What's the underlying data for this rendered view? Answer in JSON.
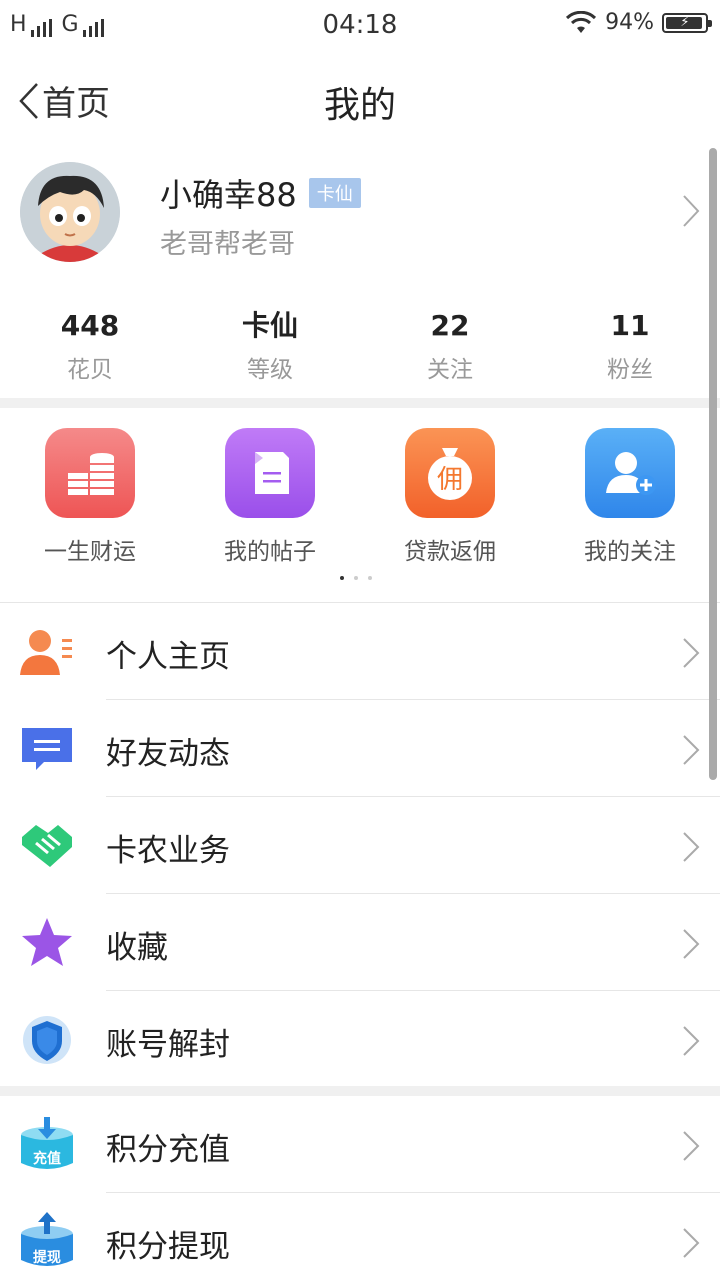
{
  "status_bar": {
    "carrier": "H",
    "network": "G",
    "time": "04:18",
    "battery": "94%",
    "battery_level": 0.94
  },
  "nav": {
    "back_label": "首页",
    "title": "我的"
  },
  "profile": {
    "username": "小确幸88",
    "level_badge": "卡仙",
    "signature": "老哥帮老哥",
    "stats": [
      {
        "value": "448",
        "label": "花贝"
      },
      {
        "value": "卡仙",
        "label": "等级"
      },
      {
        "value": "22",
        "label": "关注"
      },
      {
        "value": "11",
        "label": "粉丝"
      }
    ]
  },
  "shortcuts": [
    {
      "label": "一生财运",
      "icon": "coins-icon",
      "color": "#f26a6a"
    },
    {
      "label": "我的帖子",
      "icon": "document-icon",
      "color": "#a45cf0"
    },
    {
      "label": "贷款返佣",
      "icon": "money-bag-icon",
      "color": "#f7773a",
      "glyph": "佣"
    },
    {
      "label": "我的关注",
      "icon": "add-user-icon",
      "color": "#3d97f2"
    }
  ],
  "menu": [
    {
      "label": "个人主页",
      "icon": "person-card-icon",
      "color": "#f57a45"
    },
    {
      "label": "好友动态",
      "icon": "message-icon",
      "color": "#4a70e8"
    },
    {
      "label": "卡农业务",
      "icon": "handshake-icon",
      "color": "#2ec97a"
    },
    {
      "label": "收藏",
      "icon": "star-icon",
      "color": "#9b55e6"
    },
    {
      "label": "账号解封",
      "icon": "shield-icon",
      "color": "#1f6fd1"
    },
    {
      "label": "积分充值",
      "icon": "recharge-icon",
      "color": "#2bb8e0",
      "glyph": "充值"
    },
    {
      "label": "积分提现",
      "icon": "withdraw-icon",
      "color": "#2a8de0",
      "glyph": "提现"
    }
  ]
}
